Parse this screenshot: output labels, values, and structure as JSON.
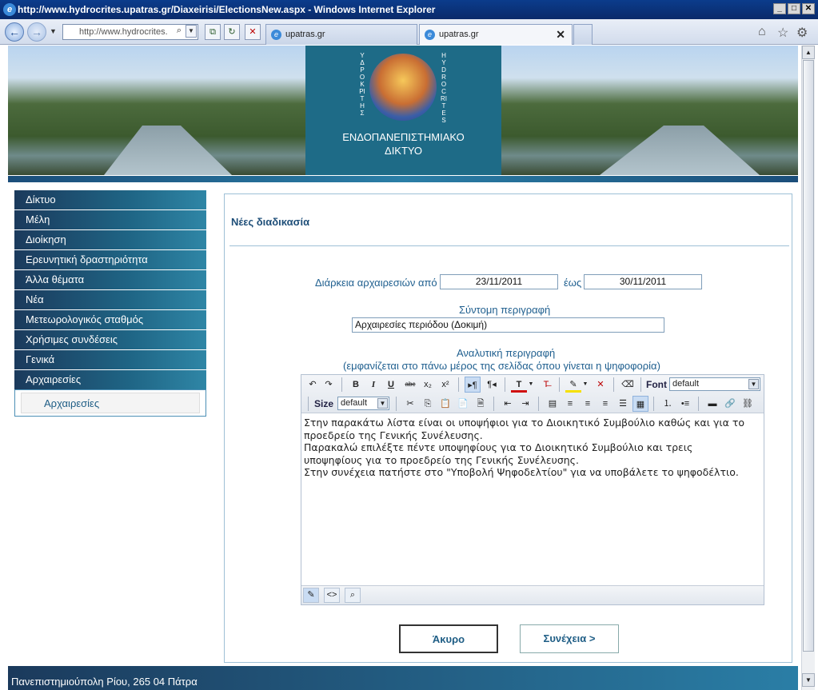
{
  "window": {
    "title": "http://www.hydrocrites.upatras.gr/Diaxeirisi/ElectionsNew.aspx - Windows Internet Explorer",
    "address_short": "http://www.hydrocrites.",
    "tabs": [
      {
        "label": "upatras.gr",
        "active": false
      },
      {
        "label": "upatras.gr",
        "active": true
      }
    ]
  },
  "banner": {
    "logo_left": "ΥΔΡΟΚΡΙΤΗΣ",
    "logo_right": "HYDROCRITES",
    "line1": "ΕΝΔΟΠΑΝΕΠΙΣΤΗΜΙΑΚΟ",
    "line2": "ΔΙΚΤΥΟ"
  },
  "sidebar": {
    "items": [
      {
        "label": "Δίκτυο"
      },
      {
        "label": "Μέλη"
      },
      {
        "label": "Διοίκηση"
      },
      {
        "label": "Ερευνητική δραστηριότητα"
      },
      {
        "label": "Άλλα θέματα"
      },
      {
        "label": "Νέα"
      },
      {
        "label": "Μετεωρολογικός σταθμός"
      },
      {
        "label": "Χρήσιμες συνδέσεις"
      },
      {
        "label": "Γενικά"
      },
      {
        "label": "Αρχαιρεσίες"
      }
    ],
    "submenu": [
      {
        "label": "Αρχαιρεσίες"
      }
    ]
  },
  "form": {
    "title": "Νέες διαδικασία",
    "duration_label": "Διάρκεια αρχαιρεσιών από",
    "from_value": "23/11/2011",
    "to_label": "έως",
    "to_value": "30/11/2011",
    "short_desc_label": "Σύντομη περιγραφή",
    "short_desc_value": "Αρχαιρεσίες περιόδου (Δοκιμή)",
    "long_desc_label": "Αναλυτική περιγραφή",
    "long_desc_hint": "(εμφανίζεται στο πάνω μέρος της σελίδας όπου γίνεται η ψηφοφορία)",
    "editor": {
      "font_label": "Font",
      "font_value": "default",
      "size_label": "Size",
      "size_value": "default",
      "body": "Στην παρακάτω λίστα είναι οι υποψήφιοι για το Διοικητικό Συμβούλιο καθώς και για το\nπροεδρείο της Γενικής Συνέλευσης.\nΠαρακαλώ επιλέξτε πέντε υποψηφίους για το Διοικητικό Συμβούλιο και τρεις\nυποψηφίους για το προεδρείο της Γενικής Συνέλευσης.\nΣτην συνέχεια πατήστε στο \"Υποβολή Ψηφοδελτίου\" για να υποβάλετε το ψηφοδέλτιο."
    },
    "cancel_label": "Άκυρο",
    "continue_label": "Συνέχεια >"
  },
  "footer": {
    "text": "Πανεπιστημιούπολη Ρίου, 265 04 Πάτρα"
  },
  "colors": {
    "accent": "#1f5f8f",
    "menu_dark": "#1b3a5c",
    "menu_light": "#2f86a6"
  }
}
